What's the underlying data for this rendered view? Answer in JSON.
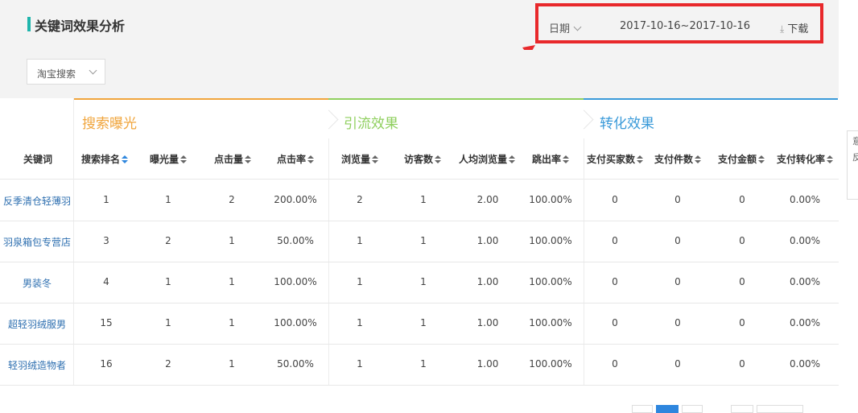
{
  "header": {
    "title": "关键词效果分析",
    "date_label": "日期",
    "date_range": "2017-10-16~2017-10-16",
    "download_label": "下载"
  },
  "filter": {
    "source_value": "淘宝搜索"
  },
  "groups": [
    {
      "label": "搜索曝光",
      "color": "#f0a53c"
    },
    {
      "label": "引流效果",
      "color": "#8fcf5e"
    },
    {
      "label": "转化效果",
      "color": "#3a9ad9"
    }
  ],
  "columns": [
    "关键词",
    "搜索排名",
    "曝光量",
    "点击量",
    "点击率",
    "浏览量",
    "访客数",
    "人均浏览量",
    "跳出率",
    "支付买家数",
    "支付件数",
    "支付金额",
    "支付转化率"
  ],
  "rows": [
    {
      "keyword": "反季清仓轻薄羽",
      "values": [
        "1",
        "1",
        "2",
        "200.00%",
        "2",
        "1",
        "2.00",
        "100.00%",
        "0",
        "0",
        "0",
        "0.00%"
      ]
    },
    {
      "keyword": "羽泉箱包专营店",
      "values": [
        "3",
        "2",
        "1",
        "50.00%",
        "1",
        "1",
        "1.00",
        "100.00%",
        "0",
        "0",
        "0",
        "0.00%"
      ]
    },
    {
      "keyword": "男装冬",
      "values": [
        "4",
        "1",
        "1",
        "100.00%",
        "1",
        "1",
        "1.00",
        "100.00%",
        "0",
        "0",
        "0",
        "0.00%"
      ]
    },
    {
      "keyword": "超轻羽绒服男",
      "values": [
        "15",
        "1",
        "1",
        "100.00%",
        "1",
        "1",
        "1.00",
        "100.00%",
        "0",
        "0",
        "0",
        "0.00%"
      ]
    },
    {
      "keyword": "轻羽绒造物者",
      "values": [
        "16",
        "2",
        "1",
        "50.00%",
        "1",
        "1",
        "1.00",
        "100.00%",
        "0",
        "0",
        "0",
        "0.00%"
      ]
    }
  ],
  "side_widget": [
    "意",
    "反"
  ],
  "colors": {
    "highlight": "#e8282b",
    "accent": "#1fb5ac",
    "link": "#2e6fb0",
    "active_page": "#2e86de"
  }
}
